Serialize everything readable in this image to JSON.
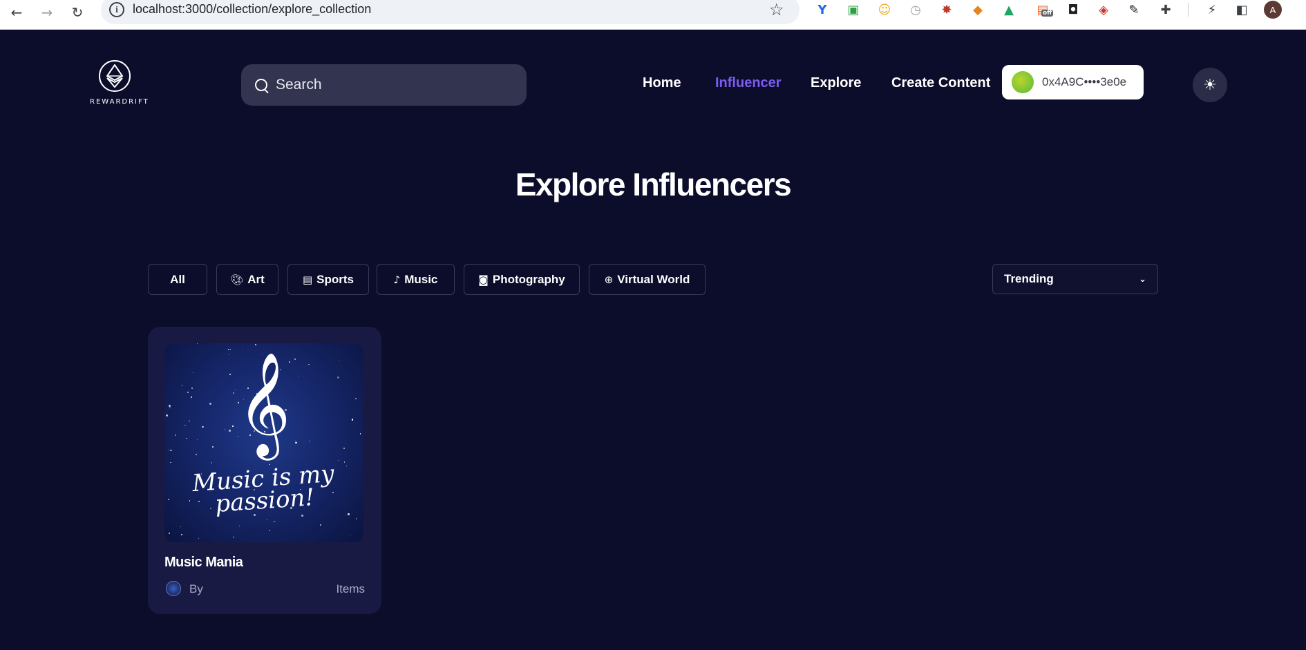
{
  "browser": {
    "url": "localhost:3000/collection/explore_collection",
    "extensions": [
      {
        "name": "y-ext-icon",
        "glyph": "Y",
        "color": "#1e6be6"
      },
      {
        "name": "camera-ext-icon",
        "glyph": "▣",
        "color": "#2f9e44"
      },
      {
        "name": "face-ext-icon",
        "glyph": "☺",
        "color": "#f2a413"
      },
      {
        "name": "clock-ext-icon",
        "glyph": "◷",
        "color": "#9aa0a6"
      },
      {
        "name": "bug-ext-icon",
        "glyph": "✸",
        "color": "#c0392b"
      },
      {
        "name": "metamask-ext-icon",
        "glyph": "◆",
        "color": "#e8831d"
      },
      {
        "name": "drive-ext-icon",
        "glyph": "▲",
        "color": "#1fa463"
      },
      {
        "name": "off-ext-icon",
        "glyph": "▤",
        "color": "#f26522",
        "badge": "off"
      },
      {
        "name": "lock-ext-icon",
        "glyph": "◘",
        "color": "#202124"
      },
      {
        "name": "shield-ext-icon",
        "glyph": "◈",
        "color": "#d93025"
      },
      {
        "name": "eyedropper-ext-icon",
        "glyph": "✎",
        "color": "#202124"
      },
      {
        "name": "puzzle-ext-icon",
        "glyph": "✚",
        "color": "#3c4043"
      }
    ],
    "avatar_letter": "A"
  },
  "header": {
    "logo_text": "REWARDRIFT",
    "search_placeholder": "Search",
    "nav": [
      {
        "label": "Home",
        "active": false
      },
      {
        "label": "Influencer",
        "active": true
      },
      {
        "label": "Explore",
        "active": false
      },
      {
        "label": "Create Content",
        "active": false
      }
    ],
    "wallet_address": "0x4A9C••••3e0e"
  },
  "main": {
    "title": "Explore Influencers",
    "filters": [
      {
        "label": "All",
        "icon": ""
      },
      {
        "label": "Art",
        "icon": "palette-icon"
      },
      {
        "label": "Sports",
        "icon": "ticket-icon"
      },
      {
        "label": "Music",
        "icon": "music-note-icon"
      },
      {
        "label": "Photography",
        "icon": "camera-icon"
      },
      {
        "label": "Virtual World",
        "icon": "globe-icon"
      }
    ],
    "sort": {
      "selected": "Trending"
    },
    "cards": [
      {
        "name": "Music Mania",
        "image_text": "Music is my passion!",
        "by_label": "By",
        "items_label": "Items"
      }
    ]
  },
  "colors": {
    "background": "#0c0d2b",
    "accent": "#7b5cf2",
    "card": "#181a43"
  }
}
